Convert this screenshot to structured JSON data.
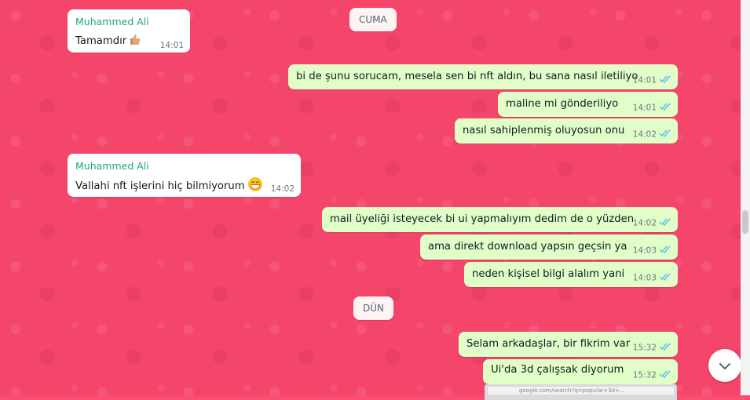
{
  "dates": {
    "cuma": "CUMA",
    "dun": "DÜN"
  },
  "messages": {
    "m1": {
      "sender": "Muhammed Ali",
      "text": "Tamamdır",
      "time": "14:01",
      "emoji": "thumbs-up"
    },
    "m2": {
      "text": "bi de şunu sorucam, mesela sen bi nft aldın, bu sana nasıl iletiliyo",
      "time": "14:01"
    },
    "m3": {
      "text": "maline mi gönderiliyo",
      "time": "14:01"
    },
    "m4": {
      "text": "nasıl sahiplenmiş oluyosun onu",
      "time": "14:02"
    },
    "m5": {
      "sender": "Muhammed Ali",
      "text": "Vallahi nft işlerini hiç bilmiyorum",
      "time": "14:02",
      "emoji": "grinning-face"
    },
    "m6": {
      "text": "mail üyeliği isteyecek bi ui yapmalıyım dedim de o yüzden",
      "time": "14:02"
    },
    "m7": {
      "text": "ama direkt download yapsın geçsin ya",
      "time": "14:03"
    },
    "m8": {
      "text": "neden kişisel bilgi alalım yani",
      "time": "14:03"
    },
    "m9": {
      "text": "Selam arkadaşlar, bir fikrim var",
      "time": "15:32"
    },
    "m10": {
      "text": "Ui'da 3d çalışsak diyorum",
      "time": "15:32"
    }
  },
  "preview": {
    "url": "google.com/search?q=popular+3d+..."
  },
  "colors": {
    "background": "#f4456a",
    "incoming": "#ffffff",
    "outgoing": "#e1fec9",
    "sender": "#1fa57e",
    "tick": "#53bdeb"
  }
}
